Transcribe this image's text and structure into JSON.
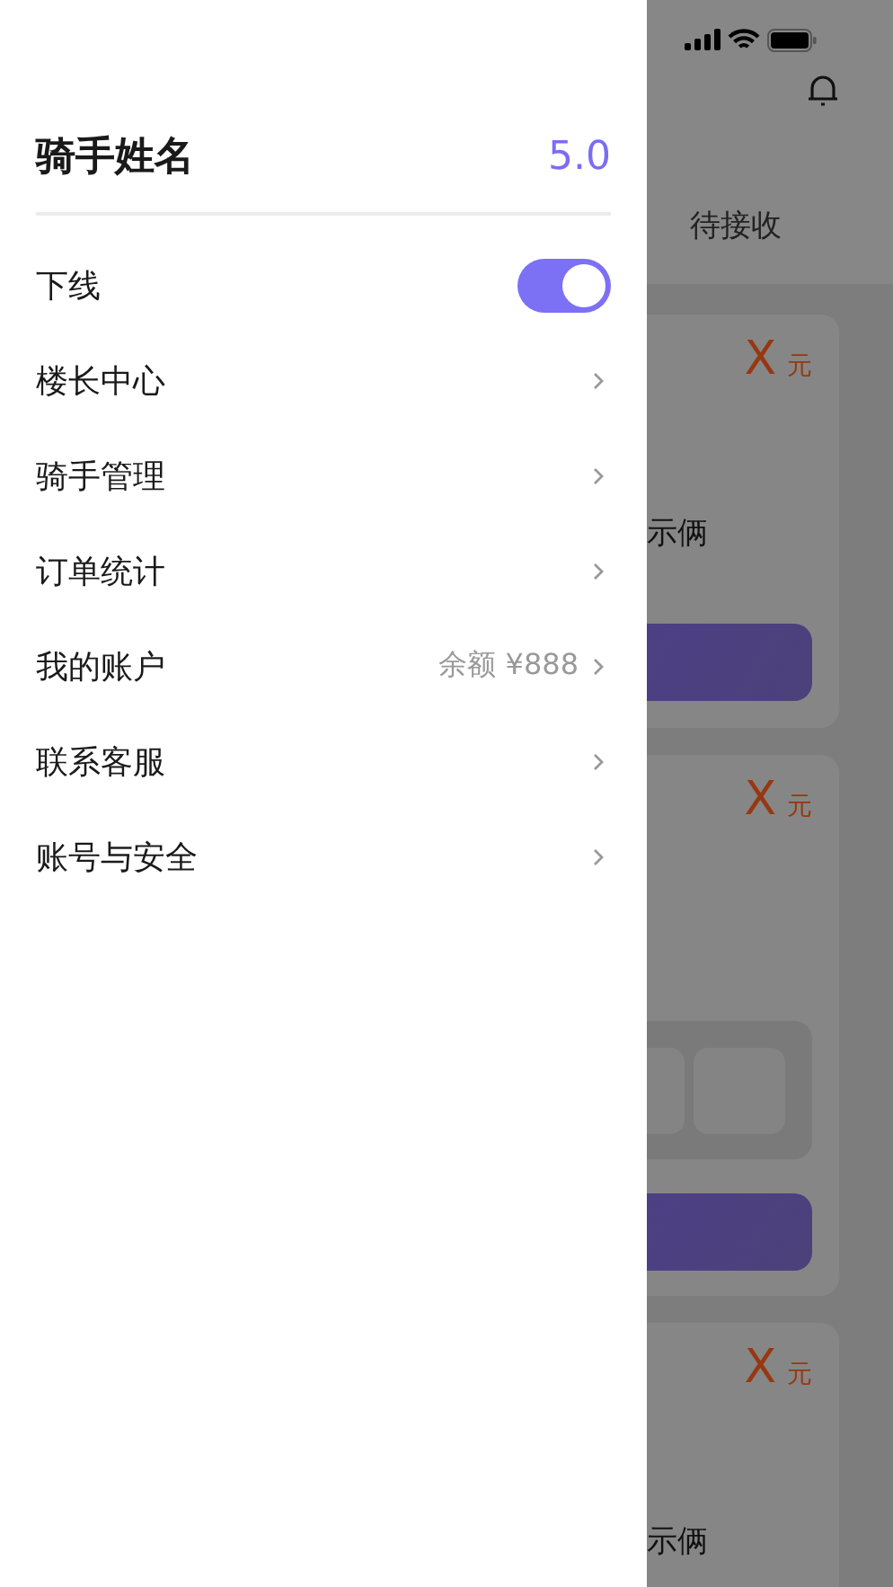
{
  "drawer": {
    "title": "骑手姓名",
    "rating": "5.0",
    "items": [
      {
        "kind": "toggle",
        "label": "下线",
        "on": true
      },
      {
        "kind": "link",
        "label": "楼长中心"
      },
      {
        "kind": "link",
        "label": "骑手管理"
      },
      {
        "kind": "link",
        "label": "订单统计"
      },
      {
        "kind": "link",
        "label": "我的账户",
        "detail": "余额 ¥888"
      },
      {
        "kind": "link",
        "label": "联系客服"
      },
      {
        "kind": "link",
        "label": "账号与安全"
      }
    ]
  },
  "background": {
    "tab": "待接收",
    "cards": [
      {
        "kind": "text-button",
        "price": "X",
        "unit": "元",
        "text": "示俩"
      },
      {
        "kind": "tiles-button",
        "price": "X",
        "unit": "元"
      },
      {
        "kind": "text",
        "price": "X",
        "unit": "元",
        "text": "示俩"
      }
    ]
  }
}
